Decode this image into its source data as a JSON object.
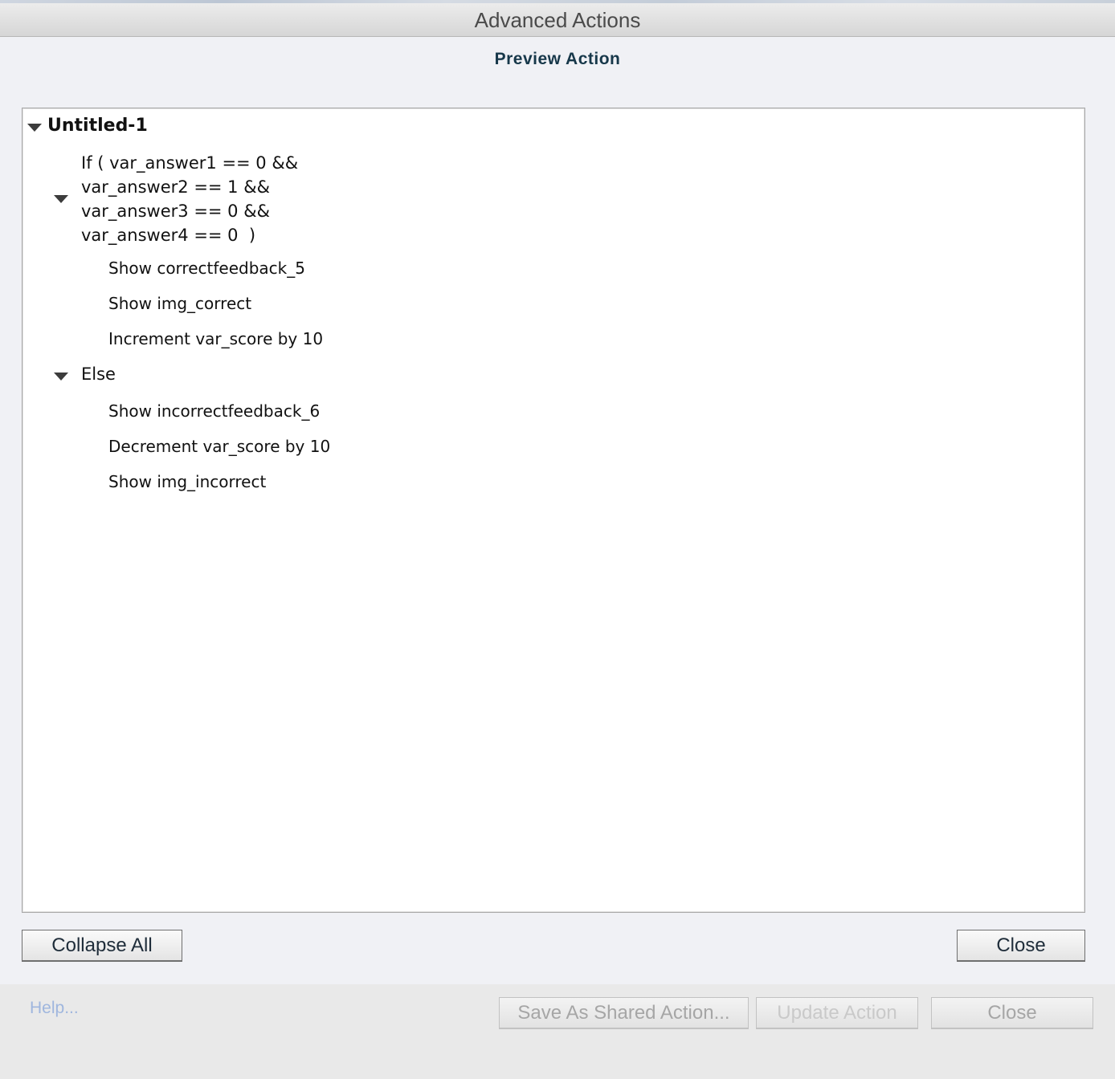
{
  "window": {
    "title": "Advanced Actions"
  },
  "panel": {
    "subtitle": "Preview Action"
  },
  "tree": {
    "root": {
      "label": "Untitled-1",
      "if_lines": [
        "If ( var_answer1 == 0 &&",
        "var_answer2 == 1 &&",
        "var_answer3 == 0 &&",
        "var_answer4 == 0  )"
      ],
      "then_actions": [
        "Show correctfeedback_5",
        "Show img_correct",
        "Increment var_score by 10"
      ],
      "else_label": "Else",
      "else_actions": [
        "Show incorrectfeedback_6",
        "Decrement var_score by 10",
        "Show img_incorrect"
      ]
    }
  },
  "buttons": {
    "collapse_all": "Collapse All",
    "close_preview": "Close"
  },
  "footer": {
    "help": "Help...",
    "save_shared": "Save As Shared Action...",
    "update_action": "Update Action",
    "close": "Close"
  }
}
